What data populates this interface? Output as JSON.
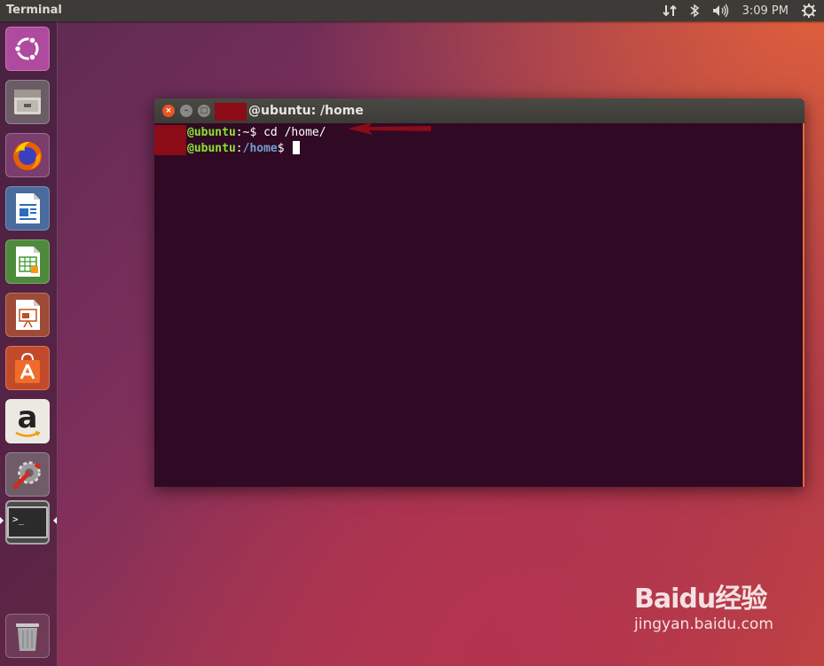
{
  "panel": {
    "app_title": "Terminal",
    "indicators": {
      "network_icon": "network-arrows-icon",
      "bluetooth_icon": "bluetooth-icon",
      "volume_icon": "speaker-icon",
      "time": "3:09 PM",
      "system_icon": "gear-power-icon"
    }
  },
  "launcher": {
    "items": [
      {
        "name": "ubuntu-dash",
        "icon": "ubuntu-logo-icon"
      },
      {
        "name": "files",
        "icon": "file-cabinet-icon"
      },
      {
        "name": "firefox",
        "icon": "firefox-icon"
      },
      {
        "name": "libreoffice-writer",
        "icon": "writer-icon"
      },
      {
        "name": "libreoffice-calc",
        "icon": "calc-icon"
      },
      {
        "name": "libreoffice-impress",
        "icon": "impress-icon"
      },
      {
        "name": "ubuntu-software",
        "icon": "software-bag-icon"
      },
      {
        "name": "amazon",
        "icon": "amazon-icon"
      },
      {
        "name": "system-settings",
        "icon": "settings-wrench-icon"
      },
      {
        "name": "terminal",
        "icon": "terminal-icon"
      },
      {
        "name": "trash",
        "icon": "trash-icon"
      }
    ],
    "terminal_prompt_glyph": ">_",
    "amazon_letter": "a"
  },
  "window": {
    "title": "@ubuntu: /home",
    "lines": [
      {
        "user": "@ubuntu",
        "sep": ":",
        "path": "~",
        "prompt": "$ ",
        "command": "cd /home/"
      },
      {
        "user": "@ubuntu",
        "sep": ":",
        "path": "/home",
        "prompt": "$ ",
        "command": ""
      }
    ]
  },
  "watermark": {
    "logo_text": "Baidu经验",
    "url": "jingyan.baidu.com"
  },
  "colors": {
    "accent": "#e95420",
    "terminal_bg": "#300a24",
    "user_green": "#8ae234",
    "path_blue": "#729fcf",
    "redaction": "#8b0b17"
  }
}
